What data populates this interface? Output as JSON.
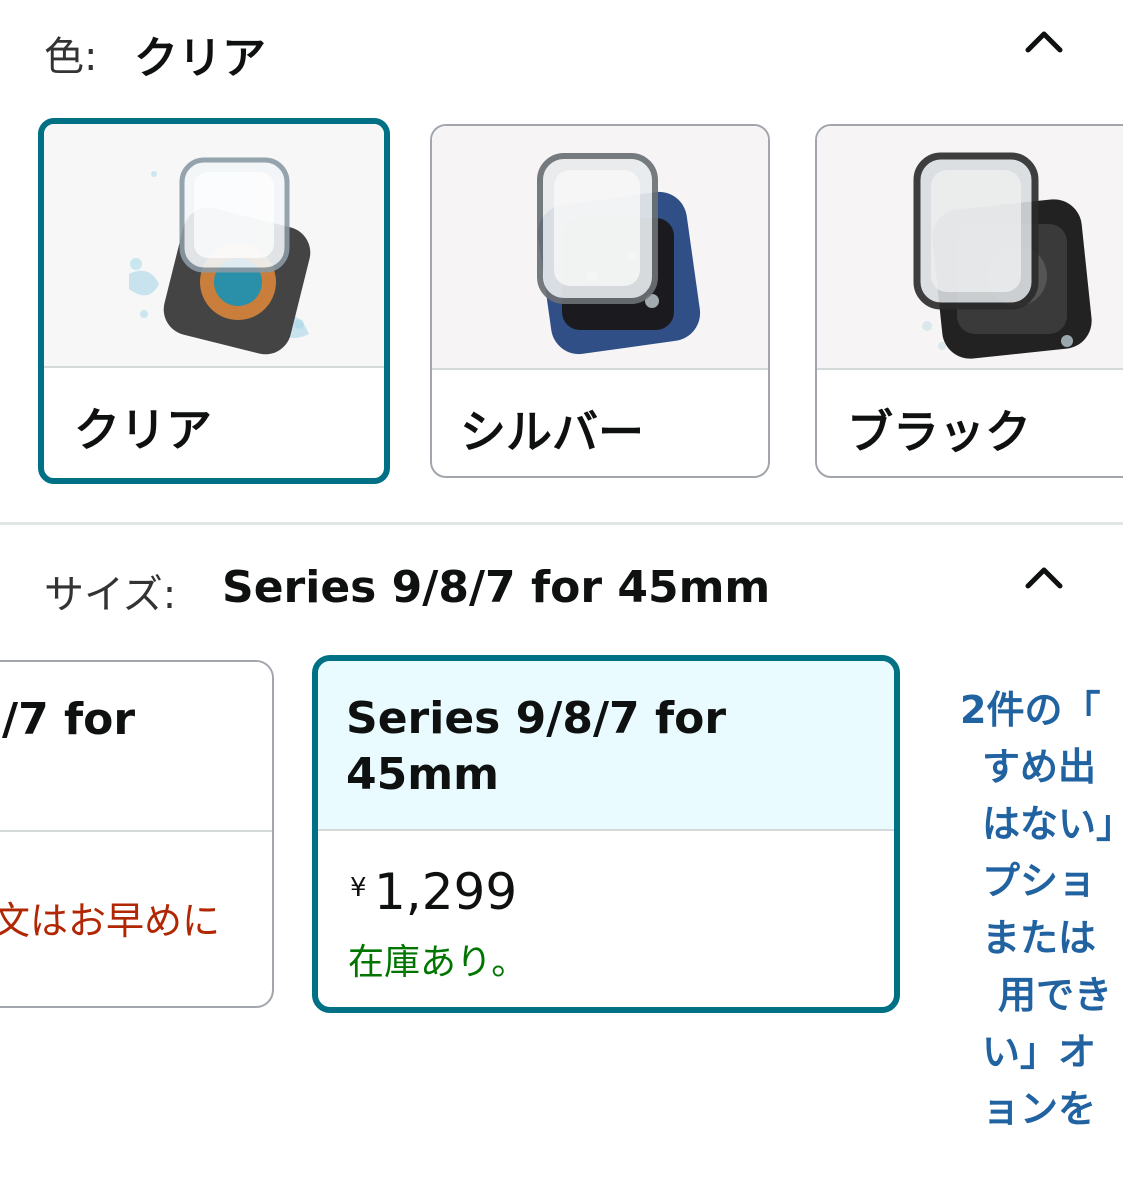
{
  "color_section": {
    "label": "色:",
    "selected_value": "クリア",
    "options": [
      {
        "name": "クリア",
        "selected": true
      },
      {
        "name": "シルバー",
        "selected": false
      },
      {
        "name": "ブラック",
        "selected": false
      }
    ]
  },
  "size_section": {
    "label": "サイズ:",
    "selected_value": "Series 9/8/7 for 45mm",
    "options": [
      {
        "title": "/7 for",
        "note": "文はお早めに"
      },
      {
        "title_line1": "Series 9/8/7 for",
        "title_line2": "45mm",
        "currency": "¥",
        "price": "1,299",
        "stock": "在庫あり。"
      }
    ]
  },
  "promo_text_lines": [
    "2件の「",
    "すめ出",
    "はない」",
    "プショ",
    "または",
    "用でき",
    "い」オ",
    "ョンを"
  ],
  "colors": {
    "accent": "#007185",
    "link": "#2162a1",
    "in_stock": "#007600",
    "warning": "#b12704",
    "selected_bg": "#eafbff"
  }
}
